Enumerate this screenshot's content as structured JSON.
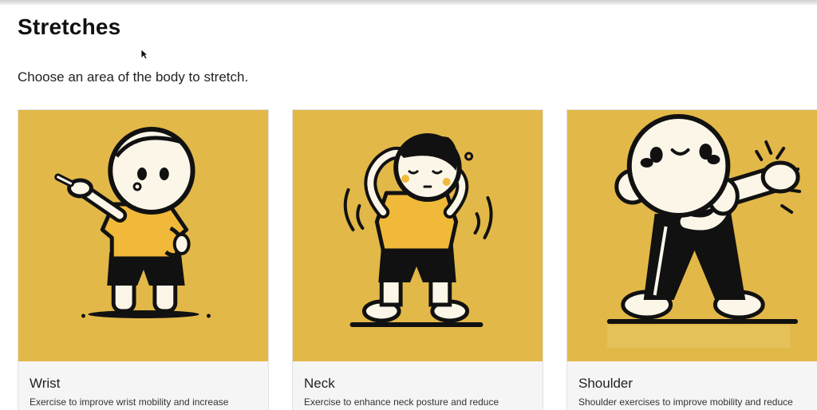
{
  "header": {
    "title": "Stretches",
    "subtitle": "Choose an area of the body to stretch."
  },
  "colors": {
    "card_background": "#e2b848",
    "shirt": "#f0b93a",
    "outline": "#111111",
    "skin": "#fbf6e8"
  },
  "cards": [
    {
      "name": "Wrist",
      "description": "Exercise to improve wrist mobility and increase",
      "icon": "wrist-stretch-illustration"
    },
    {
      "name": "Neck",
      "description": "Exercise to enhance neck posture and reduce",
      "icon": "neck-stretch-illustration"
    },
    {
      "name": "Shoulder",
      "description": "Shoulder exercises to improve mobility and reduce",
      "icon": "shoulder-stretch-illustration"
    }
  ]
}
